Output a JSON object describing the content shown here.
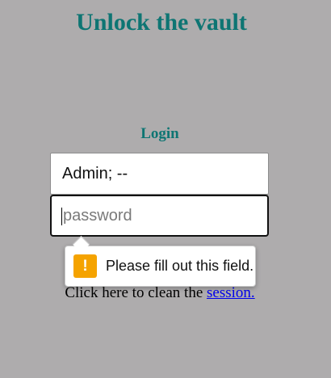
{
  "page": {
    "title": "Unlock the vault"
  },
  "form": {
    "heading": "Login",
    "username_value": "Admin; --",
    "password_placeholder": "password"
  },
  "footer": {
    "clean_text": "Click here to clean the ",
    "session_link": "session."
  },
  "tooltip": {
    "icon": "warning-icon",
    "icon_glyph": "!",
    "message": "Please fill out this field.",
    "icon_color": "#f5a300"
  },
  "colors": {
    "background": "#aeacad",
    "heading": "#0e7573",
    "link": "#0000ee"
  }
}
